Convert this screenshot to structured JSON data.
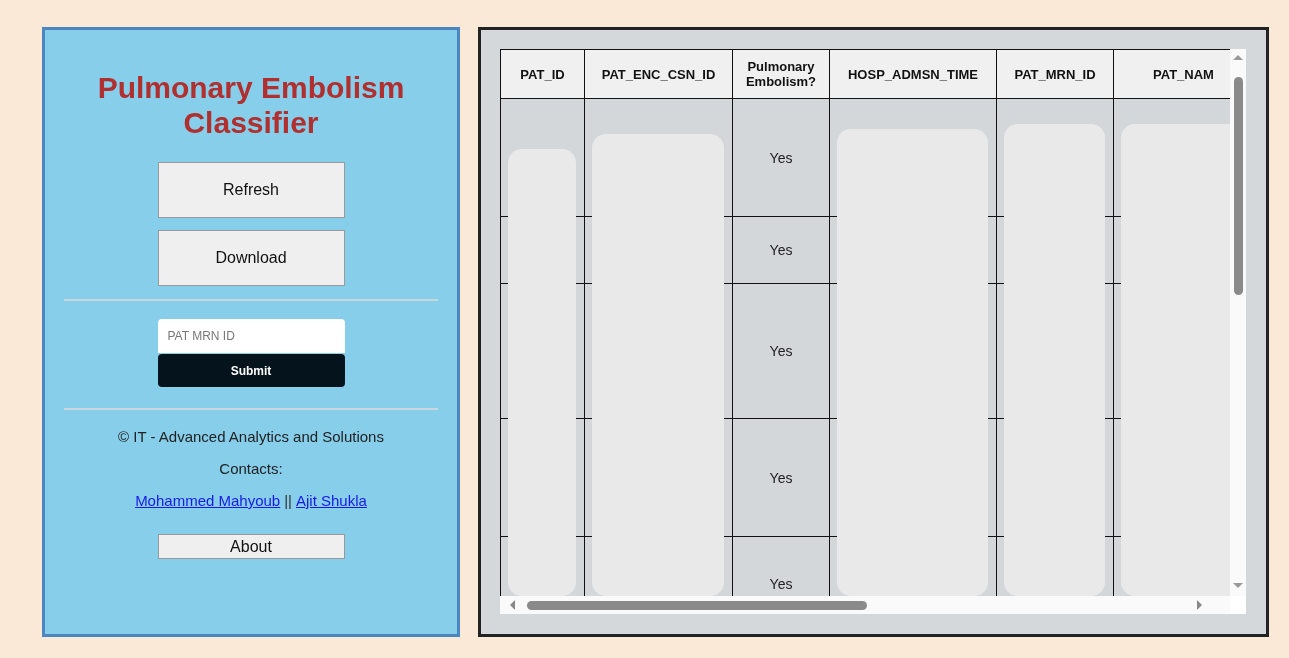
{
  "sidebar": {
    "title": "Pulmonary Embolism Classifier",
    "buttons": [
      "Refresh",
      "Download"
    ],
    "search": {
      "placeholder": "PAT MRN ID",
      "submit": "Submit"
    },
    "copyright": "© IT - Advanced Analytics and Solutions",
    "contacts_label": "Contacts:",
    "contacts": [
      {
        "name": "Mohammed Mahyoub"
      },
      {
        "name": "Ajit Shukla"
      }
    ],
    "separator": "||",
    "about": "About"
  },
  "table": {
    "columns": [
      {
        "label": "PAT_ID",
        "redacted": true
      },
      {
        "label": "PAT_ENC_CSN_ID",
        "redacted": true
      },
      {
        "label": "Pulmonary Embolism?",
        "redacted": false
      },
      {
        "label": "HOSP_ADMSN_TIME",
        "redacted": true
      },
      {
        "label": "PAT_MRN_ID",
        "redacted": true
      },
      {
        "label": "PAT_NAM",
        "redacted": true
      }
    ],
    "rows": [
      {
        "pulmonary_embolism": "Yes"
      },
      {
        "pulmonary_embolism": "Yes"
      },
      {
        "pulmonary_embolism": "Yes"
      },
      {
        "pulmonary_embolism": "Yes"
      },
      {
        "pulmonary_embolism": "Yes"
      }
    ]
  }
}
